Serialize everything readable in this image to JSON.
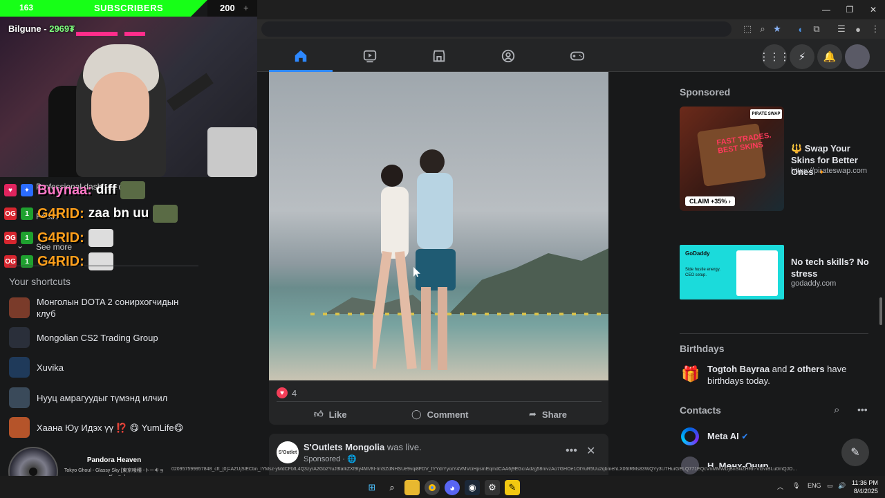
{
  "overlay": {
    "sub_count": "163",
    "sub_label": "SUBSCRIBERS",
    "sub_goal": "200",
    "sub_plus": "+",
    "cam_name": "Bilgune - ",
    "cam_points": "2969₮",
    "chat": [
      {
        "user": "Buynaa:",
        "msg": "diff"
      },
      {
        "user": "G4RID:",
        "msg": "zaa  bn uu"
      },
      {
        "user": "G4RID:",
        "msg": ""
      },
      {
        "user": "G4RID:",
        "msg": ""
      }
    ],
    "behind_text": [
      "Professional dashboard",
      "Feeds",
      "See more"
    ]
  },
  "sidebar": {
    "shortcuts_title": "Your shortcuts",
    "shortcuts": [
      {
        "label": "Монголын DOTA 2 сонирхогчидын клуб",
        "color": "#7a3b2a"
      },
      {
        "label": "Mongolian CS2 Trading Group",
        "color": "#2a2f3a"
      },
      {
        "label": "Xuvika",
        "color": "#1f3a5a"
      },
      {
        "label": "Нууц амрагуудыг түмэнд илчил",
        "color": "#3a4a5a"
      },
      {
        "label": "Хаана Юу Идэх үү ⁉️ 😋 YumLife😋",
        "color": "#b5542a"
      }
    ]
  },
  "post": {
    "reaction_count": "4",
    "like": "Like",
    "comment": "Comment",
    "share": "Share"
  },
  "post2": {
    "avatar_text": "S'Outlet",
    "name": "S'Outlets Mongolia",
    "status": "was live.",
    "sub": "Sponsored · 🌐"
  },
  "right": {
    "sponsored": "Sponsored",
    "ads": [
      {
        "title": "🔱 Swap Your Skins for Better Ones 🔸",
        "url": "https://pirateswap.com",
        "img_text": "FAST TRADES. BEST SKINS",
        "claim": "CLAIM +35% ›",
        "logo": "PIRATE SWAP"
      },
      {
        "title": "No tech skills? No stress",
        "url": "godaddy.com",
        "img_text": "GoDaddy",
        "img_sub": "Side hustle energy. CEO setup."
      }
    ],
    "birthdays_title": "Birthdays",
    "birthday_text_bold1": "Togtoh Bayraa",
    "birthday_text_mid": " and ",
    "birthday_text_bold2": "2 others",
    "birthday_text_end": " have birthdays today.",
    "contacts_title": "Contacts",
    "contacts": [
      {
        "name": "Meta AI"
      },
      {
        "name": "Н. Мөнх-Очир"
      }
    ]
  },
  "bottom": {
    "url_strip": "020957599957848_cft_[0]=AZUjSlECbn_IYMsz-yMdCFbfL4Q3zyrA2Gb2YuJ3faIkZXf9ty4MV8I-ImSZdNHSUe9vqi8FDV_fYYdrYyorY4VMVciHpsmEqmdCAA6j9EGcrAdzg58mvzAo7GHOe1OtYuR5Uu2qbmehLX06tRMs83WQYy3U7HurGELQ771EQcVnMMWDjBnSkiZHRh-VGvrBLu0mQJO...",
    "music_title": "Pandora Heaven",
    "music_sub": "Tokyo Ghoul - Glassy Sky [東京喰種 -トーキョーグール-]",
    "lang": "ENG",
    "time": "11:36 PM",
    "date": "8/4/2025"
  }
}
